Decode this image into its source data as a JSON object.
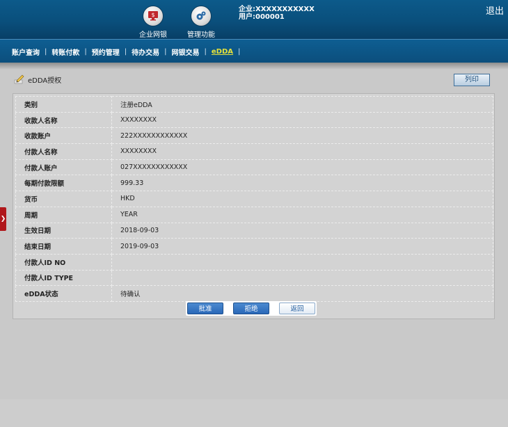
{
  "header": {
    "nav": [
      {
        "label": "企业网银",
        "icon": "monitor-dollar-icon"
      },
      {
        "label": "管理功能",
        "icon": "gears-icon"
      }
    ],
    "company_line": "企业:XXXXXXXXXXX",
    "user_line": "用户:000001",
    "logout": "退出"
  },
  "menu": {
    "items": [
      "账户查询",
      "转账付款",
      "预约管理",
      "待办交易",
      "网银交易",
      "eDDA"
    ],
    "active": "eDDA"
  },
  "page": {
    "title": "eDDA授权",
    "print_label": "列印"
  },
  "details": [
    {
      "label": "类别",
      "value": "注册eDDA"
    },
    {
      "label": "收款人名称",
      "value": "XXXXXXXX"
    },
    {
      "label": "收款账户",
      "value": "222XXXXXXXXXXXX"
    },
    {
      "label": "付款人名称",
      "value": "XXXXXXXX"
    },
    {
      "label": "付款人账户",
      "value": "027XXXXXXXXXXXX"
    },
    {
      "label": "每期付款限额",
      "value": "999.33"
    },
    {
      "label": "货币",
      "value": "HKD"
    },
    {
      "label": "周期",
      "value": "YEAR"
    },
    {
      "label": "生效日期",
      "value": "2018-09-03"
    },
    {
      "label": "结束日期",
      "value": "2019-09-03"
    },
    {
      "label": "付款人ID NO",
      "value": ""
    },
    {
      "label": "付款人ID TYPE",
      "value": ""
    },
    {
      "label": "eDDA状态",
      "value": "待确认"
    }
  ],
  "actions": {
    "approve": "批准",
    "reject": "拒绝",
    "back": "返回"
  },
  "colors": {
    "header_bg": "#0a4f7c",
    "active_menu": "#e7e23a",
    "side_tab": "#b0171b",
    "button_blue": "#2a68b8"
  }
}
